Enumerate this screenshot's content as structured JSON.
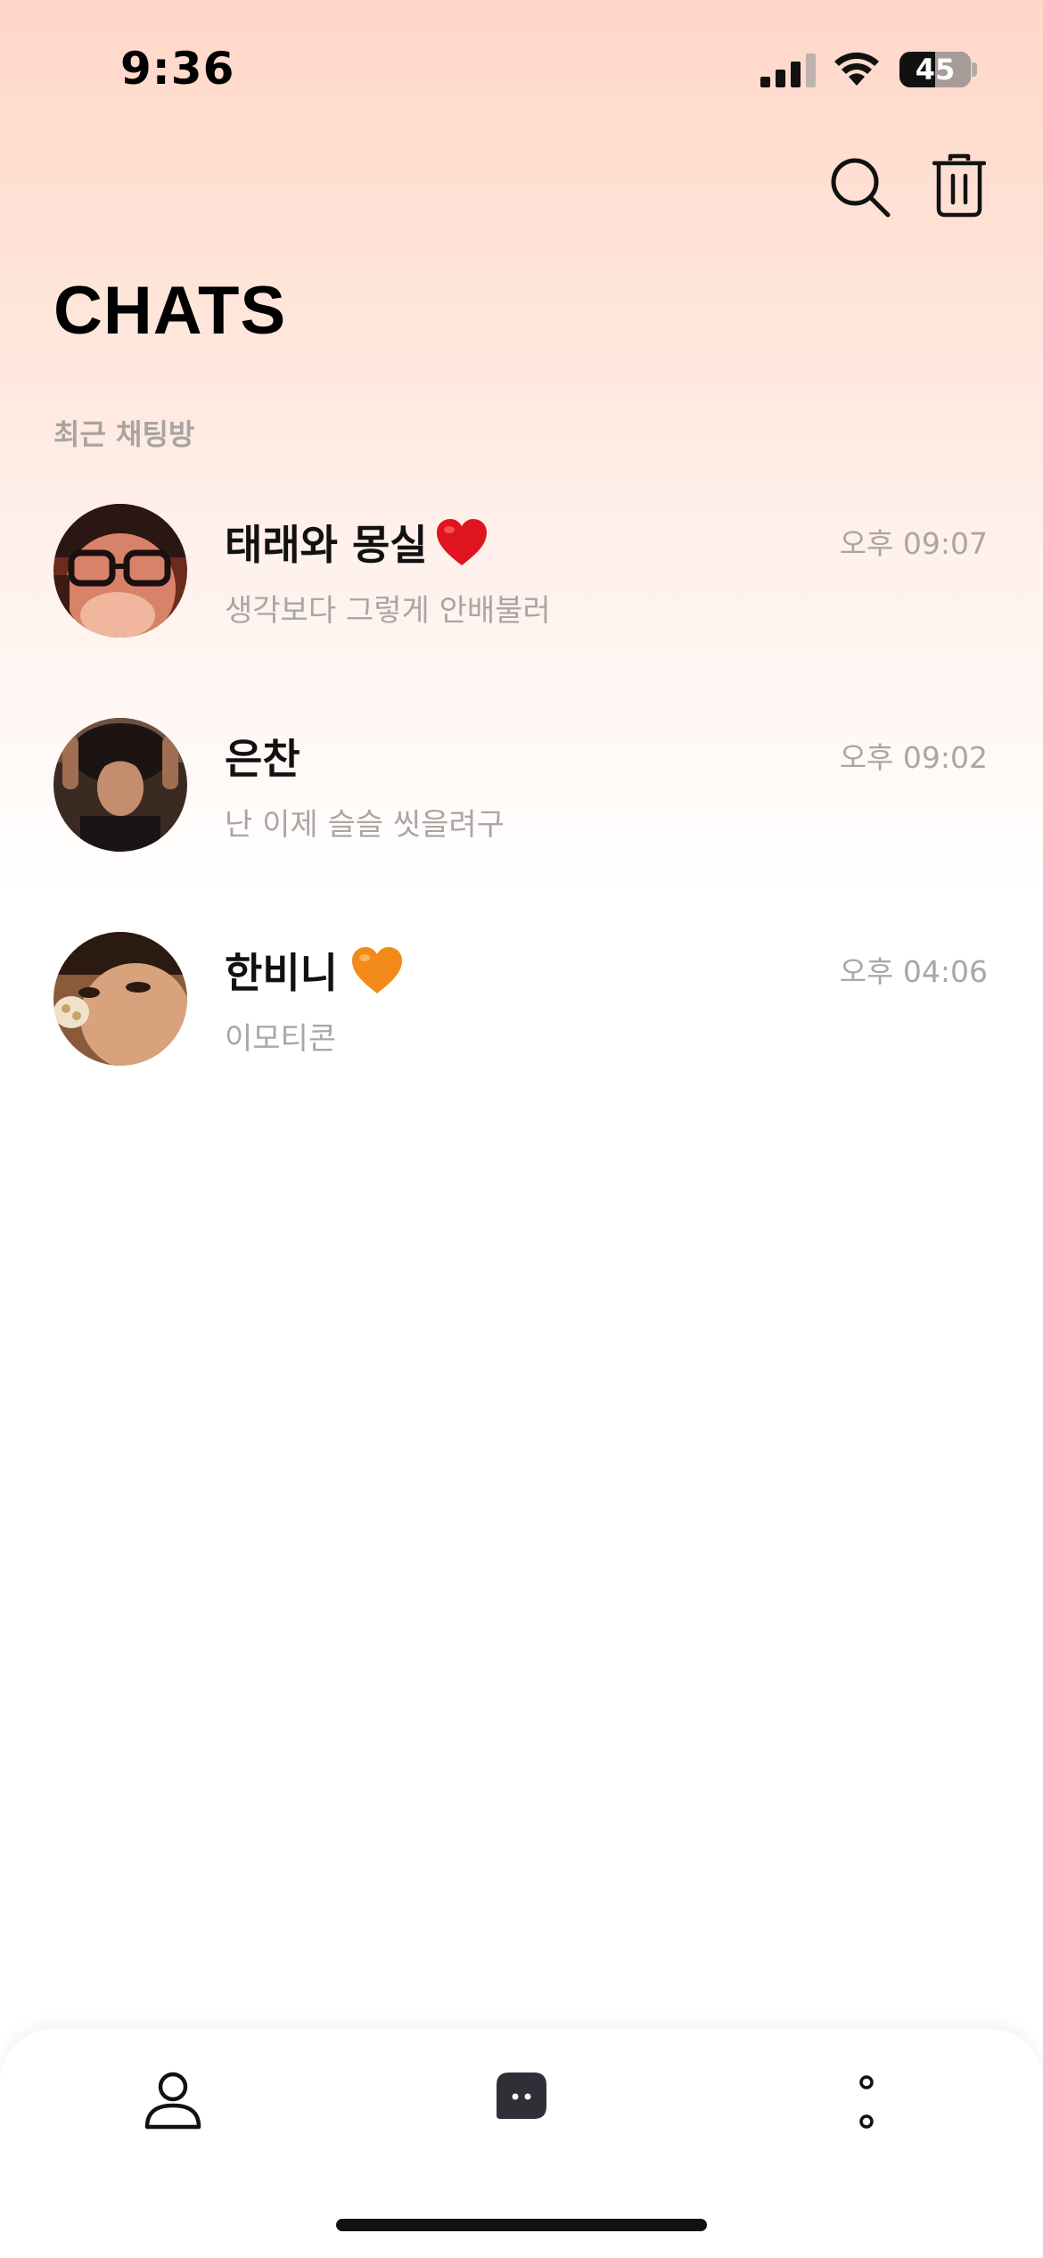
{
  "status_bar": {
    "time": "9:36",
    "battery": "45",
    "icons": [
      "cellular-signal-icon",
      "wifi-icon",
      "battery-icon"
    ]
  },
  "header": {
    "actions": [
      "search-icon",
      "trash-icon"
    ]
  },
  "page": {
    "title": "CHATS",
    "section_label": "최근 채팅방"
  },
  "chats": [
    {
      "name": "태래와 몽실",
      "name_emoji": "red-heart-icon",
      "preview": "생각보다 그렇게 안배불러",
      "time": "오후 09:07"
    },
    {
      "name": "은찬",
      "name_emoji": "",
      "preview": "난 이제 슬슬 씻을려구",
      "time": "오후 09:02"
    },
    {
      "name": "한비니",
      "name_emoji": "orange-heart-icon",
      "preview": "이모티콘",
      "time": "오후 04:06"
    }
  ],
  "tab_bar": {
    "tabs": [
      "profile-icon",
      "chat-bubble-icon",
      "more-icon"
    ],
    "active": "chat-bubble-icon"
  },
  "colors": {
    "gradient_top": "#ffd7c8",
    "secondary_text": "#aaa6a4",
    "red_heart": "#e0141e",
    "orange_heart": "#f28a1a",
    "active_tab": "#2f2f38"
  }
}
